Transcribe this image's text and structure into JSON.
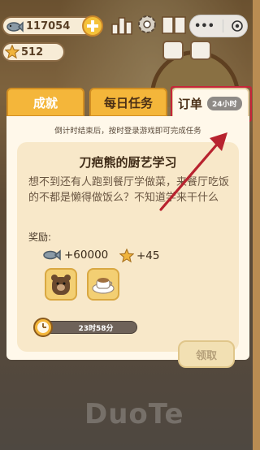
{
  "hud": {
    "fish_count": "117054",
    "star_count": "512"
  },
  "tabs": [
    {
      "label": "成就"
    },
    {
      "label": "每日任务"
    },
    {
      "label": "订单",
      "badge": "24小时"
    }
  ],
  "panel": {
    "hint": "倒计时结束后，按时登录游戏即可完成任务",
    "order": {
      "title": "刀疤熊的厨艺学习",
      "description": "想不到还有人跑到餐厅学做菜，来餐厅吃饭的不都是懒得做饭么？不知道学来干什么",
      "reward_label": "奖励:",
      "reward_fish": "+60000",
      "reward_star": "+45",
      "items": [
        "bear-portrait-icon",
        "coffee-cup-icon"
      ],
      "timer": "23时58分",
      "claim_label": "领取"
    }
  },
  "watermark": "DuoTe",
  "colors": {
    "tab_active": "#fff8ea",
    "tab_inactive": "#f4b63a",
    "highlight": "#c6263a",
    "annotation_arrow": "#b8232f"
  }
}
